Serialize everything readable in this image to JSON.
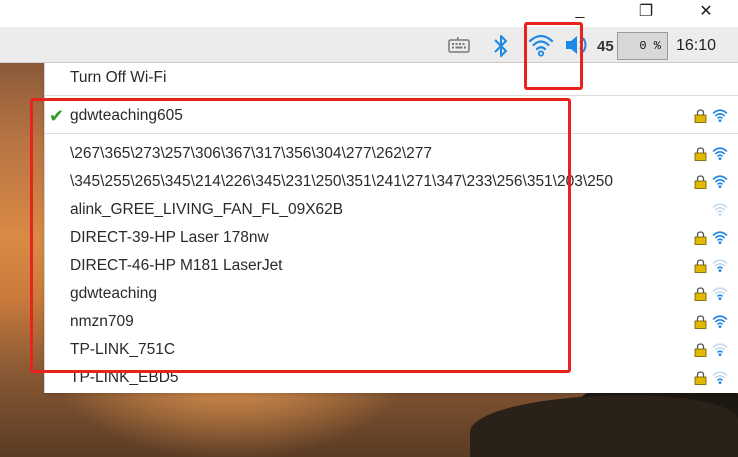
{
  "window": {
    "minimize_label": "_",
    "restore_label": "❐",
    "close_label": "✕"
  },
  "taskbar": {
    "keyboard_icon": "keyboard-icon",
    "bluetooth_icon": "bluetooth-icon",
    "wifi_icon": "wifi-icon",
    "volume_icon": "volume-icon",
    "volume_level": "45",
    "cpu_usage": "0 %",
    "clock": "16:10"
  },
  "menu": {
    "toggle_label": "Turn Off Wi-Fi",
    "connected": {
      "ssid": "gdwteaching605",
      "secured": true,
      "signal": "strong"
    },
    "networks": [
      {
        "ssid": "\\267\\365\\273\\257\\306\\367\\317\\356\\304\\277\\262\\277",
        "secured": true,
        "signal": "strong"
      },
      {
        "ssid": "\\345\\255\\265\\345\\214\\226\\345\\231\\250\\351\\241\\271\\347\\233\\256\\351\\203\\250",
        "secured": true,
        "signal": "strong"
      },
      {
        "ssid": "alink_GREE_LIVING_FAN_FL_09X62B",
        "secured": false,
        "signal": "weak"
      },
      {
        "ssid": "DIRECT-39-HP Laser 178nw",
        "secured": true,
        "signal": "strong"
      },
      {
        "ssid": "DIRECT-46-HP M181 LaserJet",
        "secured": true,
        "signal": "weak"
      },
      {
        "ssid": "gdwteaching",
        "secured": true,
        "signal": "weak"
      },
      {
        "ssid": "nmzn709",
        "secured": true,
        "signal": "strong"
      },
      {
        "ssid": "TP-LINK_751C",
        "secured": true,
        "signal": "weak"
      },
      {
        "ssid": "TP-LINK_EBD5",
        "secured": true,
        "signal": "weak"
      }
    ]
  },
  "colors": {
    "accent": "#1e88e5",
    "check": "#2e9a2e",
    "annotation": "#e8231b",
    "lock": "#e0b800"
  }
}
